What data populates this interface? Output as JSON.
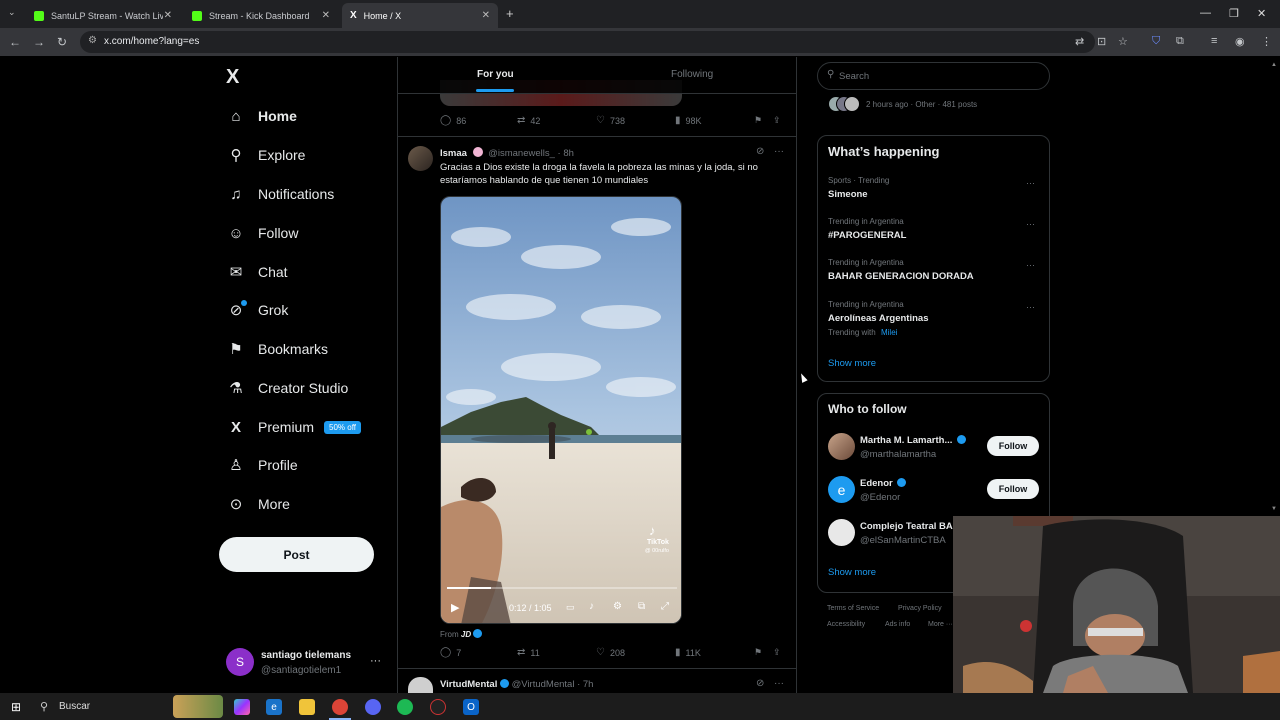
{
  "browser": {
    "tabs": [
      {
        "label": "SantuLP Stream - Watch Live o",
        "active": false
      },
      {
        "label": "Stream - Kick Dashboard",
        "active": false
      },
      {
        "label": "Home / X",
        "active": true
      }
    ],
    "url": "x.com/home?lang=es",
    "new_tab": "+",
    "close": "✕"
  },
  "nav": {
    "logo": "X",
    "items": [
      {
        "label": "Home",
        "icon": "home-icon"
      },
      {
        "label": "Explore",
        "icon": "search-icon"
      },
      {
        "label": "Notifications",
        "icon": "bell-icon"
      },
      {
        "label": "Follow",
        "icon": "person-add-icon"
      },
      {
        "label": "Chat",
        "icon": "envelope-icon"
      },
      {
        "label": "Grok",
        "icon": "grok-icon"
      },
      {
        "label": "Bookmarks",
        "icon": "bookmark-icon"
      },
      {
        "label": "Creator Studio",
        "icon": "flask-icon"
      },
      {
        "label": "Premium",
        "icon": "x-icon"
      },
      {
        "label": "Profile",
        "icon": "person-icon"
      },
      {
        "label": "More",
        "icon": "more-circle-icon"
      }
    ],
    "premium_badge": "50% off",
    "post_button": "Post",
    "account": {
      "initial": "S",
      "name": "santiago tielemans",
      "handle": "@santiagotielem1",
      "menu": "···"
    }
  },
  "feed": {
    "tabs": {
      "for_you": "For you",
      "following": "Following"
    },
    "prev_post_actions": {
      "replies": "86",
      "reposts": "42",
      "likes": "738",
      "views": "98K"
    },
    "post": {
      "author": "Ismaa",
      "handle": "@ismanewells_",
      "time": "· 8h",
      "text_line1": "Gracias a Dios existe la droga la favela la pobreza las minas y la joda, si no",
      "text_line2": "estaríamos hablando de que tienen 10 mundiales",
      "video_time": "0:12 / 1:05",
      "watermark_brand": "TikTok",
      "watermark_user": "@ 00rulfo",
      "video_progress": 0.19,
      "from_prefix": "From",
      "from_name": "JD",
      "actions": {
        "replies": "7",
        "reposts": "11",
        "likes": "208",
        "views": "11K"
      }
    },
    "next_post": {
      "author": "VirtudMental",
      "handle": "@VirtudMental",
      "time": "· 7h"
    }
  },
  "sidebar": {
    "search_placeholder": "Search",
    "space_meta": "2 hours ago · Other · 481 posts",
    "happening_title": "What’s happening",
    "trends": [
      {
        "meta": "Sports · Trending",
        "name": "Simeone"
      },
      {
        "meta": "Trending in Argentina",
        "name": "#PAROGENERAL"
      },
      {
        "meta": "Trending in Argentina",
        "name": "BAHAR GENERACION DORADA"
      },
      {
        "meta": "Trending in Argentina",
        "name": "Aerolíneas Argentinas",
        "sub_prefix": "Trending with",
        "sub_link": "Milei"
      }
    ],
    "show_more": "Show more",
    "wtf_title": "Who to follow",
    "wtf": [
      {
        "name": "Martha M. Lamarth...",
        "handle": "@marthalamartha",
        "button": "Follow"
      },
      {
        "name": "Edenor",
        "handle": "@Edenor",
        "button": "Follow"
      },
      {
        "name": "Complejo Teatral BA",
        "handle": "@elSanMartinCTBA"
      }
    ],
    "wtf_show_more": "Show more",
    "footer": [
      "Terms of Service",
      "Privacy Policy",
      "Accessibility",
      "Ads info",
      "More ···"
    ]
  },
  "taskbar": {
    "search": "Buscar"
  },
  "colors": {
    "accent": "#1d9bf0",
    "bg": "#000000",
    "border": "#2f3336",
    "muted": "#71767b"
  }
}
